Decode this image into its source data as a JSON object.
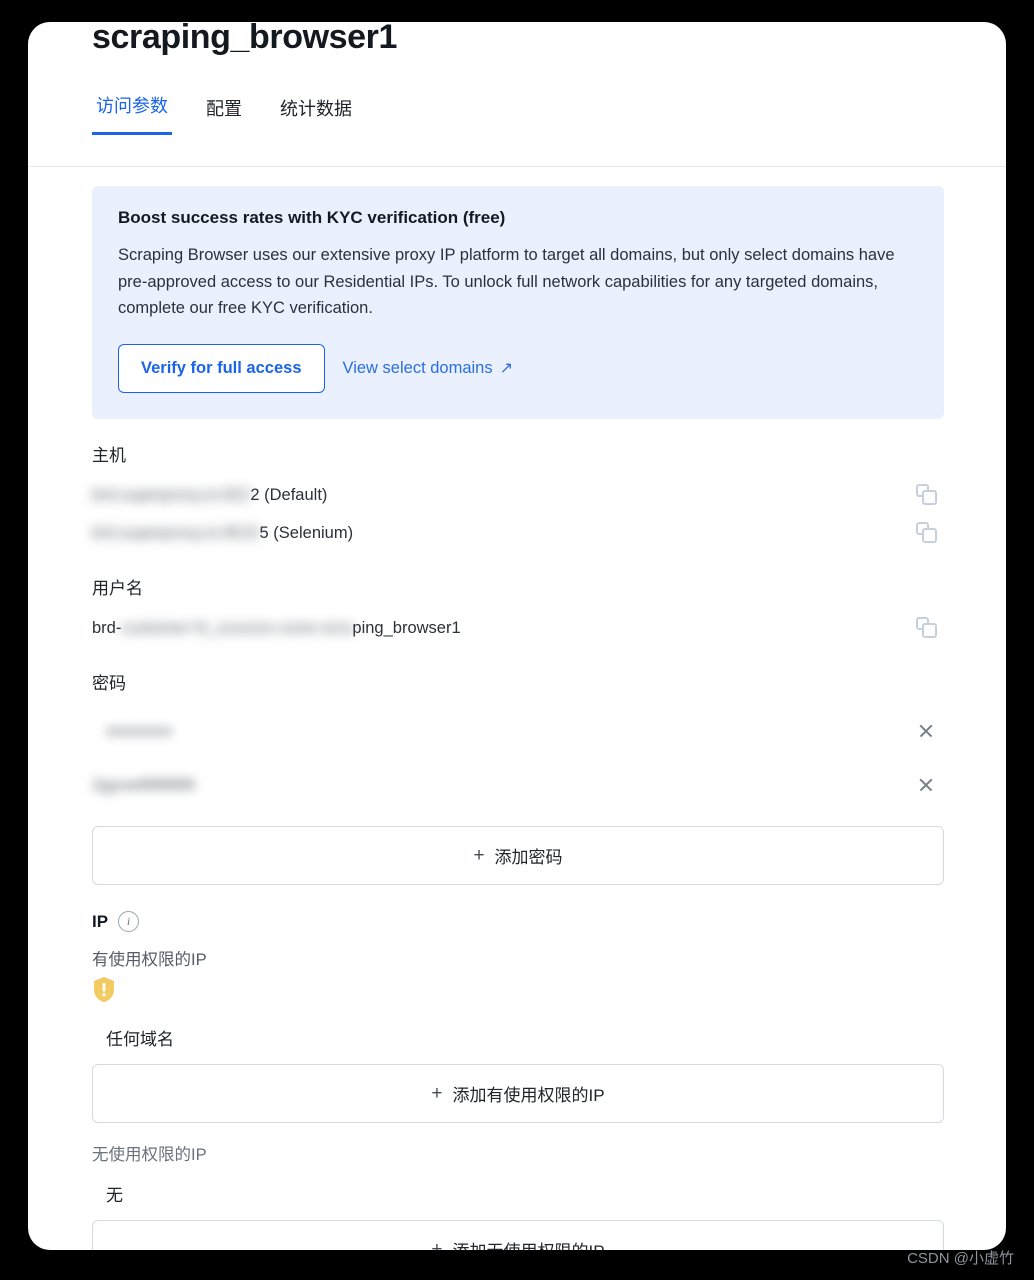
{
  "page": {
    "title": "scraping_browser1"
  },
  "tabs": [
    {
      "label": "访问参数",
      "active": true
    },
    {
      "label": "配置",
      "active": false
    },
    {
      "label": "统计数据",
      "active": false
    }
  ],
  "kyc_banner": {
    "title": "Boost success rates with KYC verification (free)",
    "body": "Scraping Browser uses our extensive proxy IP platform to target all domains, but only select domains have pre-approved access to our Residential IPs. To unlock full network capabilities for any targeted domains, complete our free KYC verification.",
    "verify_button": "Verify for full access",
    "view_domains_link": "View select domains",
    "link_arrow": "↗",
    "background_color": "#eaf0fe",
    "accent_color": "#1a64e8"
  },
  "host_section": {
    "label": "主机",
    "rows": [
      {
        "redacted": "brd.superproxy.io:922",
        "suffix": "2 (Default)",
        "copy_icon": "copy-icon"
      },
      {
        "redacted": "brd.superproxy.io:9515",
        "suffix": "5 (Selenium)",
        "copy_icon": "copy-icon"
      }
    ]
  },
  "username_section": {
    "label": "用户名",
    "prefix": "brd-",
    "redacted": "customer-hl_xxxxxxx-zone-scra",
    "suffix": "ping_browser1",
    "copy_icon": "copy-icon"
  },
  "password_section": {
    "label": "密码",
    "rows": [
      {
        "redacted": "xxxxxxxx",
        "remove_icon": "close-icon"
      },
      {
        "redacted": "2gyuw888888",
        "visible_tail": "2gyuw888888",
        "remove_icon": "close-icon"
      }
    ],
    "add_button": "添加密码",
    "add_icon": "plus-icon"
  },
  "ip_section": {
    "label": "IP",
    "info_icon": "info-icon",
    "allowed": {
      "label": "有使用权限的IP",
      "warning_icon": "shield-warning-icon",
      "warning_color": "#f2cb63",
      "items": [
        "任何域名"
      ],
      "add_button": "添加有使用权限的IP",
      "add_icon": "plus-icon"
    },
    "denied": {
      "label": "无使用权限的IP",
      "items": [
        "无"
      ],
      "add_button": "添加无使用权限的IP",
      "add_icon": "plus-icon"
    }
  },
  "watermark": "CSDN @小虚竹"
}
